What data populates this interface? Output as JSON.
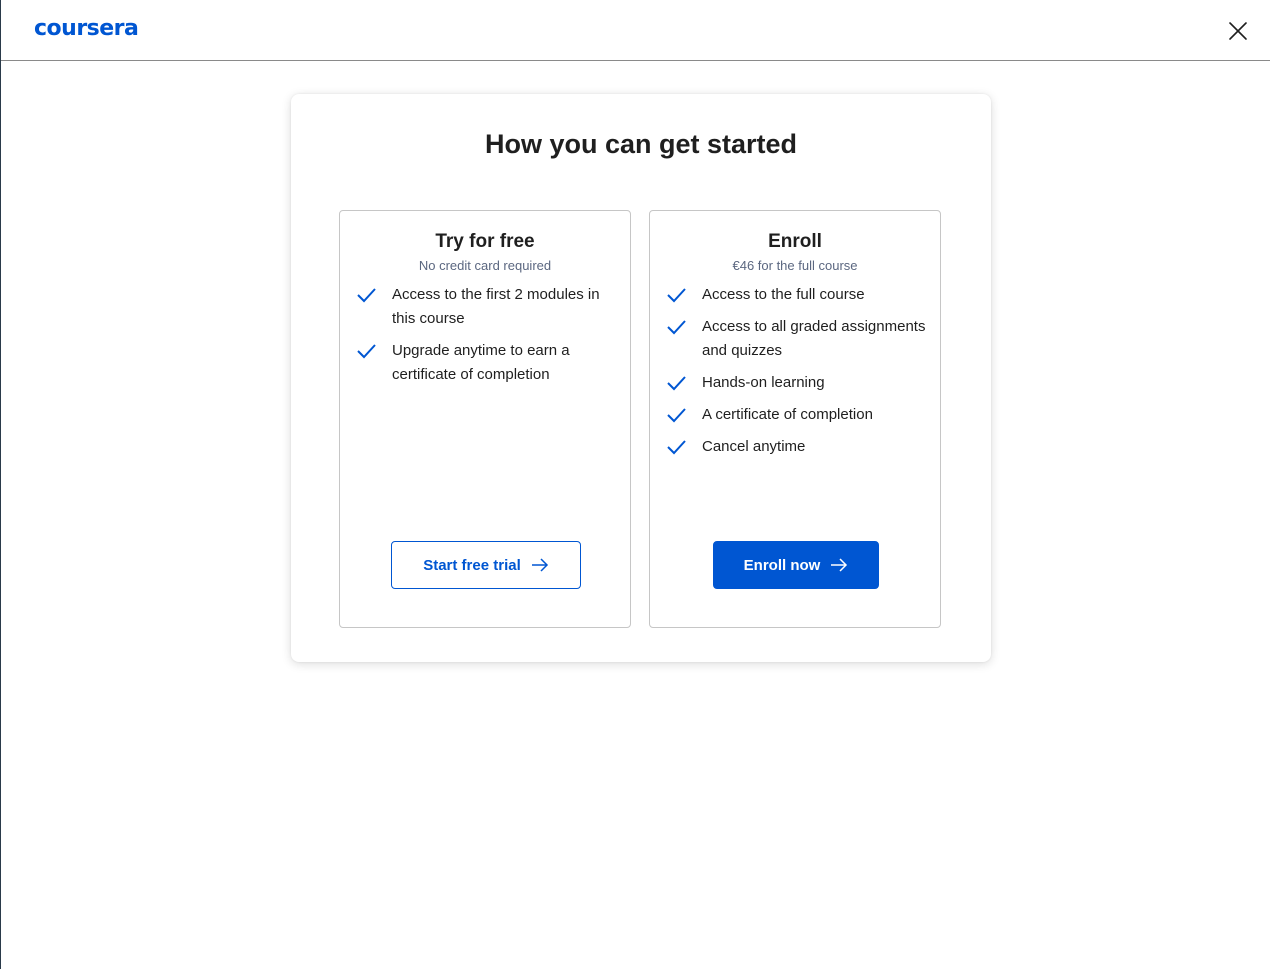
{
  "header": {
    "logo_text": "coursera",
    "close_icon": "close-icon"
  },
  "modal": {
    "title": "How you can get started",
    "options": [
      {
        "title": "Try for free",
        "subtitle": "No credit card required",
        "features": [
          "Access to the first 2 modules in this course",
          "Upgrade anytime to earn a certificate of completion"
        ],
        "button_label": "Start free trial"
      },
      {
        "title": "Enroll",
        "subtitle": "€46 for the full course",
        "features": [
          "Access to the full course",
          "Access to all graded assignments and quizzes",
          "Hands-on learning",
          "A certificate of completion",
          "Cancel anytime"
        ],
        "button_label": "Enroll now"
      }
    ]
  },
  "colors": {
    "brand": "#0056d2",
    "text": "#1f1f1f",
    "subtext": "#5b6780"
  },
  "icons": {
    "feature": "check-icon",
    "button": "arrow-right-icon"
  }
}
